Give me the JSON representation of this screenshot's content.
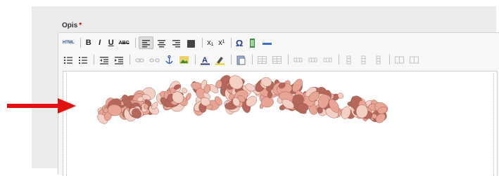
{
  "field": {
    "label": "Opis",
    "required_mark": "*"
  },
  "toolbar": {
    "row1": [
      {
        "name": "html-source-icon",
        "text": "HTML"
      },
      {
        "sep": true
      },
      {
        "name": "bold-button",
        "text": "B",
        "bold": true
      },
      {
        "name": "italic-button",
        "text": "I",
        "italic": true
      },
      {
        "name": "underline-button",
        "text": "U",
        "underline": true
      },
      {
        "name": "strikethrough-button",
        "text": "ABC",
        "strike": true
      },
      {
        "sep": true
      },
      {
        "name": "align-left-button",
        "icon": "align-left",
        "active": true
      },
      {
        "name": "align-center-button",
        "icon": "align-center"
      },
      {
        "name": "align-right-button",
        "icon": "align-right"
      },
      {
        "name": "align-justify-button",
        "icon": "align-justify"
      },
      {
        "sep": true
      },
      {
        "name": "subscript-button",
        "text": "x₁"
      },
      {
        "name": "superscript-button",
        "text": "x¹"
      },
      {
        "sep": true
      },
      {
        "name": "special-char-button",
        "text": "Ω"
      },
      {
        "name": "media-button",
        "icon": "film"
      },
      {
        "name": "horizontal-rule-button",
        "icon": "hr"
      }
    ],
    "row2": [
      {
        "name": "bullet-list-button",
        "icon": "ul"
      },
      {
        "name": "numbered-list-button",
        "icon": "ol"
      },
      {
        "sep": true
      },
      {
        "name": "outdent-button",
        "icon": "outdent"
      },
      {
        "name": "indent-button",
        "icon": "indent"
      },
      {
        "sep": true
      },
      {
        "name": "link-button",
        "icon": "link",
        "dim": true
      },
      {
        "name": "unlink-button",
        "icon": "unlink",
        "dim": true
      },
      {
        "name": "anchor-button",
        "icon": "anchor"
      },
      {
        "name": "image-button",
        "icon": "image"
      },
      {
        "sep": true
      },
      {
        "name": "text-color-button",
        "icon": "text-color"
      },
      {
        "name": "highlight-color-button",
        "icon": "highlight"
      },
      {
        "sep": true
      },
      {
        "name": "paste-word-button",
        "icon": "paste"
      },
      {
        "sep": true
      },
      {
        "name": "table-button",
        "icon": "table",
        "dim": true
      },
      {
        "name": "table-props-button",
        "icon": "table",
        "dim": true
      },
      {
        "sep": true
      },
      {
        "name": "row-before-button",
        "icon": "row",
        "dim": true
      },
      {
        "name": "row-after-button",
        "icon": "row",
        "dim": true
      },
      {
        "name": "delete-row-button",
        "icon": "row",
        "dim": true
      },
      {
        "sep": true
      },
      {
        "name": "col-before-button",
        "icon": "col",
        "dim": true
      },
      {
        "name": "col-after-button",
        "icon": "col",
        "dim": true
      },
      {
        "name": "delete-col-button",
        "icon": "col",
        "dim": true
      },
      {
        "sep": true
      },
      {
        "name": "merge-cells-button",
        "icon": "cells",
        "dim": true
      },
      {
        "name": "split-cells-button",
        "icon": "cells",
        "dim": true
      }
    ]
  },
  "colors": {
    "arrow": "#e31010",
    "required": "#cc0000",
    "stone_light": "#e8a596",
    "stone_dark": "#b4675a",
    "stone_pale": "#f3cfc4"
  }
}
